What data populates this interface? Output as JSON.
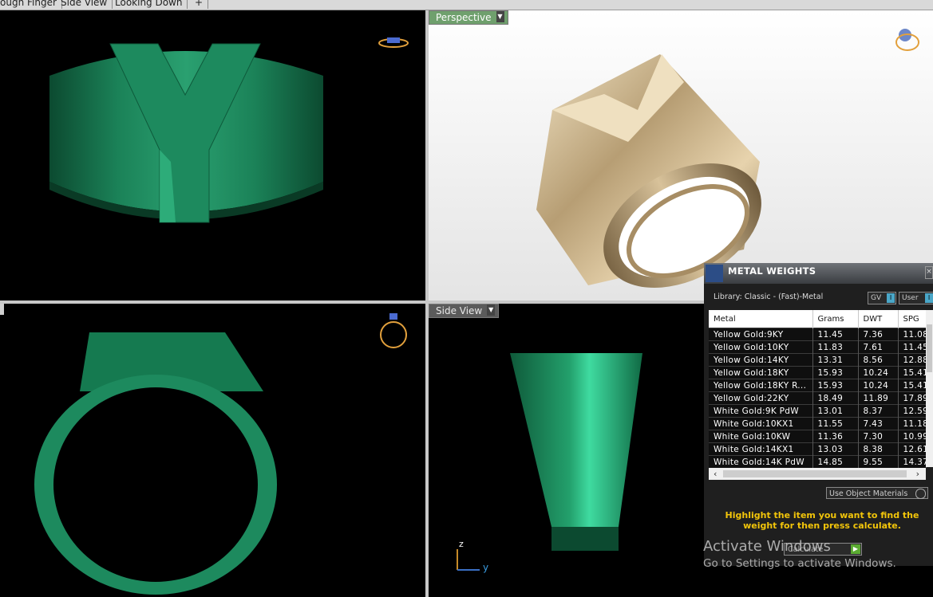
{
  "tabs": [
    "ough Finger",
    "Side View",
    "Looking Down",
    "+"
  ],
  "viewports": {
    "perspective_label": "Perspective",
    "side_label": "Side View",
    "axis_z": "z",
    "axis_y": "y"
  },
  "panel": {
    "title": "METAL WEIGHTS",
    "library": "Library: Classic - (Fast)-Metal",
    "gv_label": "GV",
    "user_label": "User",
    "columns": [
      "Metal",
      "Grams",
      "DWT",
      "SPG"
    ],
    "rows": [
      {
        "metal": "Yellow Gold:9KY",
        "grams": "11.45",
        "dwt": "7.36",
        "spg": "11.08"
      },
      {
        "metal": "Yellow Gold:10KY",
        "grams": "11.83",
        "dwt": "7.61",
        "spg": "11.45"
      },
      {
        "metal": "Yellow Gold:14KY",
        "grams": "13.31",
        "dwt": "8.56",
        "spg": "12.88"
      },
      {
        "metal": "Yellow Gold:18KY",
        "grams": "15.93",
        "dwt": "10.24",
        "spg": "15.41"
      },
      {
        "metal": "Yellow Gold:18KY R...",
        "grams": "15.93",
        "dwt": "10.24",
        "spg": "15.41"
      },
      {
        "metal": "Yellow Gold:22KY",
        "grams": "18.49",
        "dwt": "11.89",
        "spg": "17.89"
      },
      {
        "metal": "White Gold:9K PdW",
        "grams": "13.01",
        "dwt": "8.37",
        "spg": "12.59"
      },
      {
        "metal": "White Gold:10KX1",
        "grams": "11.55",
        "dwt": "7.43",
        "spg": "11.18"
      },
      {
        "metal": "White Gold:10KW",
        "grams": "11.36",
        "dwt": "7.30",
        "spg": "10.99"
      },
      {
        "metal": "White Gold:14KX1",
        "grams": "13.03",
        "dwt": "8.38",
        "spg": "12.61"
      },
      {
        "metal": "White Gold:14K PdW",
        "grams": "14.85",
        "dwt": "9.55",
        "spg": "14.37"
      }
    ],
    "use_object_materials": "Use Object Materials",
    "hint": "Highlight the item you want to find the weight for then press calculate.",
    "calculate_label": "Calculate"
  },
  "watermark": {
    "line1": "Activate Windows",
    "line2": "Go to Settings to activate Windows."
  },
  "colors": {
    "ring_green": "#1e8c5c",
    "ring_gold": "#c9b48e",
    "label_green": "#6fa06d",
    "hint_yellow": "#f2c50a"
  }
}
